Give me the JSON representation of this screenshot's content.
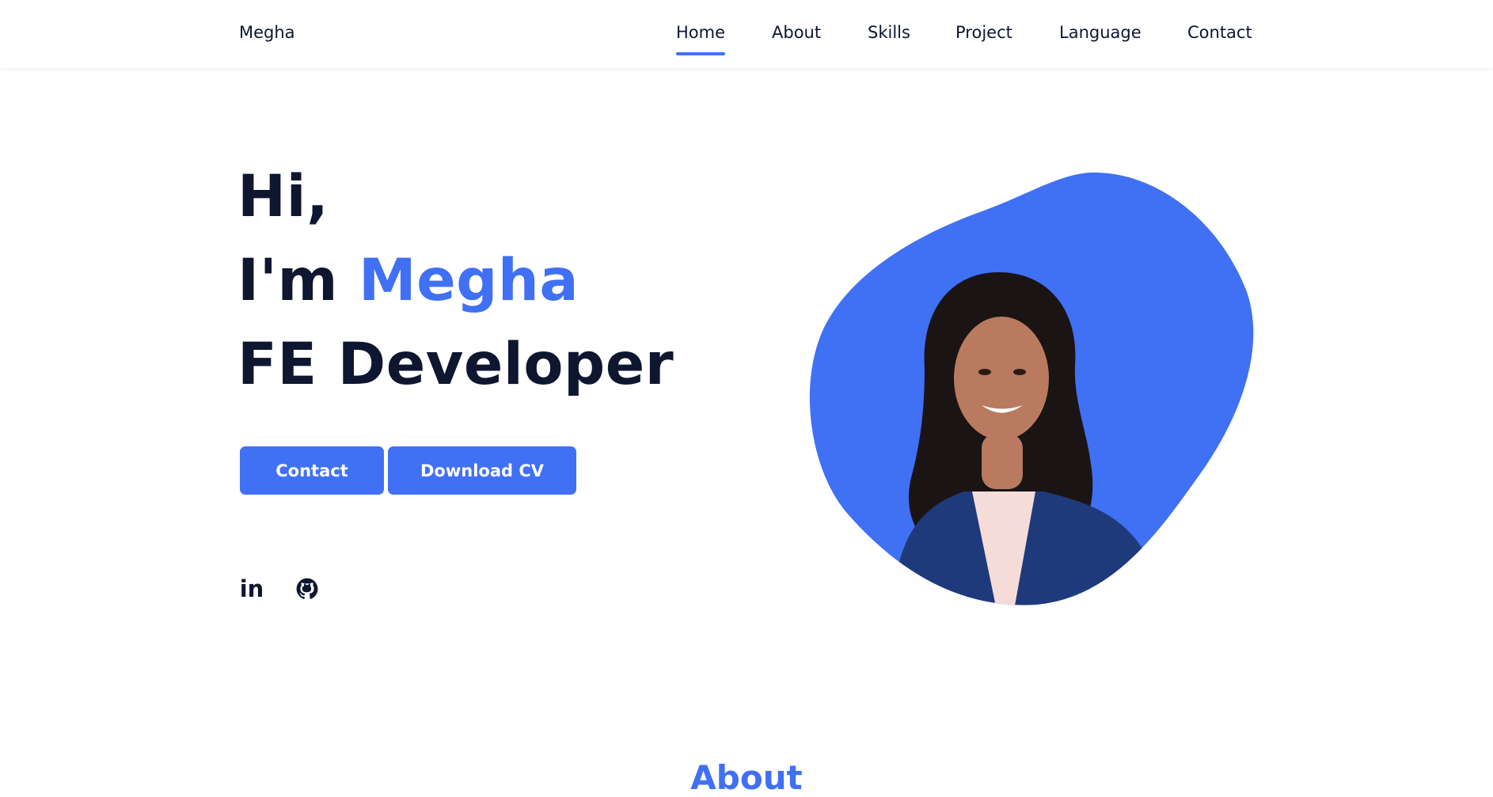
{
  "header": {
    "logo": "Megha",
    "nav": [
      {
        "label": "Home",
        "active": true
      },
      {
        "label": "About",
        "active": false
      },
      {
        "label": "Skills",
        "active": false
      },
      {
        "label": "Project",
        "active": false
      },
      {
        "label": "Language",
        "active": false
      },
      {
        "label": "Contact",
        "active": false
      }
    ]
  },
  "hero": {
    "line1": "Hi,",
    "line2_prefix": "I'm",
    "name": "Megha",
    "line3": "FE Developer",
    "buttons": {
      "contact": "Contact",
      "download": "Download CV"
    },
    "social": {
      "linkedin": "in"
    }
  },
  "about": {
    "heading": "About"
  },
  "colors": {
    "accent": "#4070f4",
    "text": "#0e1630",
    "background": "#ffffff",
    "jacket": "#1e3a7b",
    "shirt": "#f6dcd8",
    "hair": "#1a1414",
    "skin": "#b97a5f"
  },
  "icons": [
    "linkedin-icon",
    "github-icon"
  ]
}
